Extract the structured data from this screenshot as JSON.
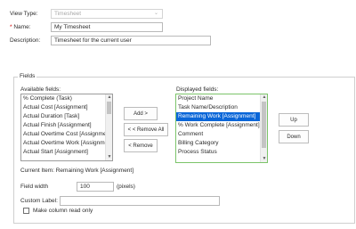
{
  "form": {
    "view_type_label": "View Type:",
    "view_type_value": "Timesheet",
    "name_required_mark": "*",
    "name_label": "Name:",
    "name_value": "My Timesheet",
    "description_label": "Description:",
    "description_value": "Timesheet for the current user"
  },
  "fields": {
    "group_title": "Fields",
    "available_label": "Available fields:",
    "available_items": [
      "% Complete (Task)",
      "Actual Cost [Assignment]",
      "Actual Duration [Task]",
      "Actual Finish [Assignment]",
      "Actual Overtime Cost [Assignment]",
      "Actual Overtime Work [Assignment]",
      "Actual Start [Assignment]"
    ],
    "displayed_label": "Displayed fields:",
    "displayed_items": [
      "Project Name",
      "Task Name/Description",
      "Remaining Work [Assignment]",
      "% Work Complete [Assignment]",
      "Comment",
      "Billing Category",
      "Process Status"
    ],
    "add_button": "Add >",
    "remove_all_button": "< < Remove All",
    "remove_button": "< Remove",
    "up_button": "Up",
    "down_button": "Down",
    "current_item_text": "Current Item: Remaining Work [Assignment]",
    "field_width_label": "Field width",
    "field_width_value": "100",
    "field_width_unit": "(pixels)",
    "custom_label_label": "Custom Label:",
    "custom_label_value": "",
    "readonly_label": "Make column read only"
  },
  "colors": {
    "selection": "#0a66d8",
    "required": "#d00000",
    "focus_border": "#7cc46a"
  },
  "icons": {
    "dropdown": "chevron-down-icon",
    "scroll_up": "scroll-up-arrow-icon",
    "scroll_down": "scroll-down-arrow-icon"
  }
}
